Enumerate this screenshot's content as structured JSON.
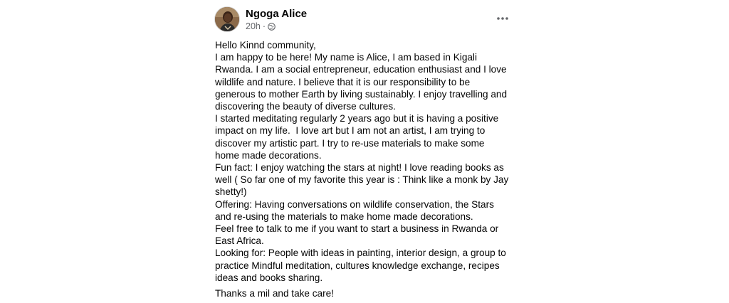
{
  "post": {
    "author": "Ngoga Alice",
    "time": "20h",
    "separator": "·",
    "privacy_icon": "globe-icon",
    "more_icon": "more-options-icon",
    "body": "Hello Kinnd community,\nI am happy to be here! My name is Alice, I am based in Kigali\nRwanda. I am a social entrepreneur, education enthusiast and I love\nwildlife and nature. I believe that it is our responsibility to be\ngenerous to mother Earth by living sustainably. I enjoy travelling and\ndiscovering the beauty of diverse cultures.\nI started meditating regularly 2 years ago but it is having a positive\nimpact on my life.  I love art but I am not an artist, I am trying to\ndiscover my artistic part. I try to re-use materials to make some\nhome made decorations.\nFun fact: I enjoy watching the stars at night! I love reading books as\nwell ( So far one of my favorite this year is : Think like a monk by Jay\nshetty!)\nOffering: Having conversations on wildlife conservation, the Stars\nand re-using the materials to make home made decorations.\nFeel free to talk to me if you want to start a business in Rwanda or\nEast Africa.\nLooking for: People with ideas in painting, interior design, a group to\npractice Mindful meditation, cultures knowledge exchange, recipes\nideas and books sharing.",
    "sign_off": "Thanks a mil and take care!"
  },
  "colors": {
    "text": "#050505",
    "secondary_text": "#65676b",
    "background": "#ffffff"
  }
}
